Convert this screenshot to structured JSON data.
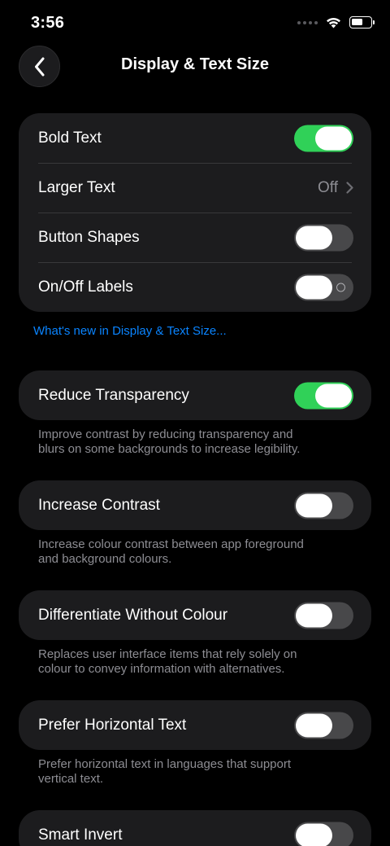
{
  "status_bar": {
    "time": "3:56",
    "icons": [
      "cellular-signal-icon",
      "wifi-icon",
      "battery-icon"
    ]
  },
  "nav": {
    "back_icon": "chevron-left-icon",
    "title": "Display & Text Size"
  },
  "group1": {
    "rows": [
      {
        "label": "Bold Text",
        "control": "toggle",
        "on": true
      },
      {
        "label": "Larger Text",
        "control": "disclosure",
        "value": "Off"
      },
      {
        "label": "Button Shapes",
        "control": "toggle",
        "on": false
      },
      {
        "label": "On/Off Labels",
        "control": "toggle",
        "on": false
      }
    ]
  },
  "whats_new_link": "What's new in Display & Text Size...",
  "sections": [
    {
      "label": "Reduce Transparency",
      "on": true,
      "footnote_lines": [
        "Improve contrast by reducing transparency and",
        "blurs on some backgrounds to increase legibility."
      ]
    },
    {
      "label": "Increase Contrast",
      "on": false,
      "footnote_lines": [
        "Increase colour contrast between app foreground",
        "and background colours."
      ]
    },
    {
      "label": "Differentiate Without Colour",
      "on": false,
      "footnote_lines": [
        "Replaces user interface items that rely solely on",
        "colour to convey information with alternatives."
      ]
    },
    {
      "label": "Prefer Horizontal Text",
      "on": false,
      "footnote_lines": [
        "Prefer horizontal text in languages that support",
        "vertical text."
      ]
    },
    {
      "label": "Smart Invert",
      "on": false
    }
  ],
  "colors": {
    "background": "#000000",
    "cell": "#1c1c1e",
    "toggle_on": "#30d158",
    "toggle_off": "#48484a",
    "link": "#0a84ff",
    "secondary_text": "#8d8d93"
  }
}
